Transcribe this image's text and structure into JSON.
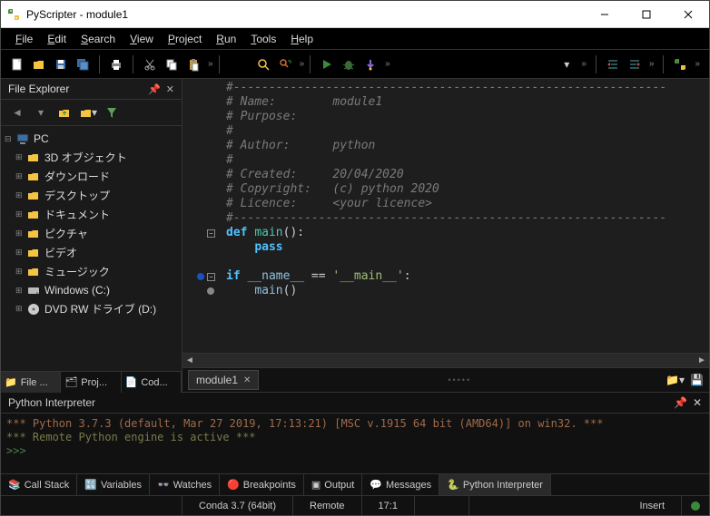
{
  "window": {
    "title": "PyScripter - module1"
  },
  "menu": {
    "file": "File",
    "edit": "Edit",
    "search": "Search",
    "view": "View",
    "project": "Project",
    "run": "Run",
    "tools": "Tools",
    "help": "Help"
  },
  "explorer": {
    "title": "File Explorer",
    "root": "PC",
    "items": [
      {
        "label": "3D オブジェクト",
        "icon": "folder"
      },
      {
        "label": "ダウンロード",
        "icon": "folder"
      },
      {
        "label": "デスクトップ",
        "icon": "folder"
      },
      {
        "label": "ドキュメント",
        "icon": "folder"
      },
      {
        "label": "ピクチャ",
        "icon": "folder"
      },
      {
        "label": "ビデオ",
        "icon": "folder"
      },
      {
        "label": "ミュージック",
        "icon": "folder"
      },
      {
        "label": "Windows (C:)",
        "icon": "drive"
      },
      {
        "label": "DVD RW ドライブ (D:)",
        "icon": "disc"
      }
    ]
  },
  "sidebar_tabs": {
    "file": "File ...",
    "project": "Proj...",
    "code": "Cod..."
  },
  "editor": {
    "tab": "module1",
    "comment_dashes": "#-------------------------------------------------------------",
    "name_line": "# Name:        module1",
    "purpose_line": "# Purpose:",
    "hash": "#",
    "author_line": "# Author:      python",
    "created_line": "# Created:     20/04/2020",
    "copyright_line": "# Copyright:   (c) python 2020",
    "licence_line": "# Licence:     <your licence>",
    "def_kw": "def",
    "main_name": "main",
    "parens": "():",
    "pass_kw": "pass",
    "if_kw": "if",
    "name_dunder": "__name__",
    "eq": " == ",
    "main_str": "'__main__'",
    "colon": ":",
    "main_call": "main",
    "call_parens": "()"
  },
  "interpreter": {
    "title": "Python Interpreter",
    "line1": "*** Python 3.7.3 (default, Mar 27 2019, 17:13:21) [MSC v.1915 64 bit (AMD64)] on win32. ***",
    "line2": "*** Remote Python engine is active ***",
    "prompt": ">>>"
  },
  "bottom_tabs": {
    "callstack": "Call Stack",
    "variables": "Variables",
    "watches": "Watches",
    "breakpoints": "Breakpoints",
    "output": "Output",
    "messages": "Messages",
    "interpreter": "Python Interpreter"
  },
  "status": {
    "env": "Conda 3.7 (64bit)",
    "engine": "Remote",
    "pos": "17:1",
    "mode": "Insert"
  }
}
